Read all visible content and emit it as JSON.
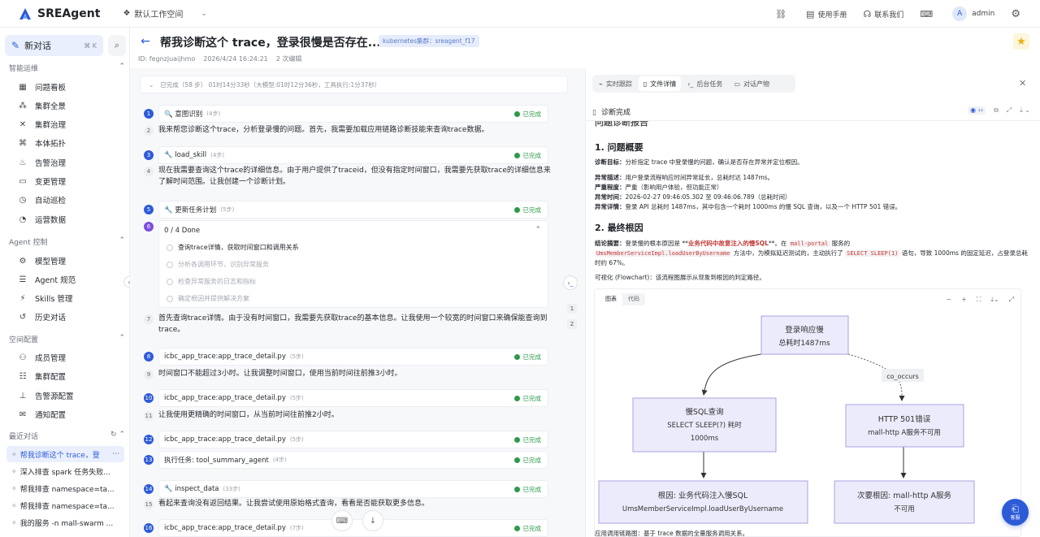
{
  "app": {
    "name": "SREAgent",
    "workspace": "默认工作空间"
  },
  "topbar": {
    "topology": "⛓",
    "manual": "使用手册",
    "contact": "联系我们",
    "lang": "中英",
    "avatar": "A",
    "user": "admin"
  },
  "sidebar": {
    "new_chat": "新对话",
    "shortcut": "⌘ K",
    "sections": [
      {
        "title": "智能运维",
        "items": [
          "问题看板",
          "集群全景",
          "集群治理",
          "本体拓扑",
          "告警治理",
          "变更管理",
          "自动巡检",
          "运营数据"
        ]
      },
      {
        "title": "Agent 控制",
        "items": [
          "模型管理",
          "Agent 规范",
          "Skills 管理",
          "历史对话"
        ]
      },
      {
        "title": "空间配置",
        "items": [
          "成员管理",
          "集群配置",
          "告警源配置",
          "通知配置"
        ]
      }
    ],
    "recent_title": "最近对话",
    "recent": [
      "帮我诊断这个 trace，登",
      "深入排查 spark 任务失败...",
      "帮我排查 namespace=ta...",
      "帮我排查 namespace=ta...",
      "我的服务 -n mall-swarm ..."
    ]
  },
  "header": {
    "title": "帮我诊断这个 trace，登录很慢是否存在...",
    "tag": "kubernetes集群：sreagent_f17",
    "id": "ID: fegnzjuaijhmo",
    "time": "2026/4/24 16:24:21",
    "edits": "2 次编辑"
  },
  "conv": {
    "status": "已完成（58 步） 01时14分33秒（大模型:01时12分36秒，工具执行:1分37秒）",
    "steps": [
      {
        "n": "1",
        "type": "tool",
        "name": "🔍 意图识别",
        "tag": "(4步)"
      },
      {
        "n": "2",
        "type": "msg",
        "text": "我来帮您诊断这个trace，分析登录慢的问题。首先，我需要加载应用链路诊断技能来查询trace数据。"
      },
      {
        "n": "3",
        "type": "tool",
        "name": "🔧 load_skill",
        "tag": "(4步)"
      },
      {
        "n": "4",
        "type": "msg",
        "text": "现在我需要查询这个trace的详细信息。由于用户提供了traceid，但没有指定时间窗口，我需要先获取trace的详细信息来了解时间范围。让我创建一个诊断计划。"
      },
      {
        "n": "5",
        "type": "tool",
        "name": "🔧 更新任务计划",
        "tag": "(5步)"
      },
      {
        "n": "6",
        "type": "plan"
      },
      {
        "n": "7",
        "type": "msg",
        "text": "首先查询trace详情。由于没有时间窗口，我需要先获取trace的基本信息。让我使用一个较宽的时间窗口来确保能查询到trace。"
      },
      {
        "n": "8",
        "type": "tool",
        "name": "icbc_app_trace:app_trace_detail.py",
        "tag": "(5步)"
      },
      {
        "n": "9",
        "type": "msg",
        "text": "时间窗口不能超过3小时。让我调整时间窗口，使用当前时间往前推3小时。"
      },
      {
        "n": "10",
        "type": "tool",
        "name": "icbc_app_trace:app_trace_detail.py",
        "tag": "(5步)"
      },
      {
        "n": "11",
        "type": "msg",
        "text": "让我使用更精确的时间窗口，从当前时间往前推2小时。"
      },
      {
        "n": "12",
        "type": "tool",
        "name": "icbc_app_trace:app_trace_detail.py",
        "tag": "(5步)"
      },
      {
        "n": "13",
        "type": "tool",
        "name": "执行任务: tool_summary_agent",
        "tag": "(4步)"
      },
      {
        "n": "14",
        "type": "tool",
        "name": "🔧 inspect_data",
        "tag": "(33步)"
      },
      {
        "n": "15",
        "type": "msg",
        "text": "看起来查询没有返回结果。让我尝试使用原始格式查询，看看是否能获取更多信息。"
      },
      {
        "n": "16",
        "type": "tool",
        "name": "icbc_app_trace:app_trace_detail.py",
        "tag": "(7步)"
      }
    ],
    "done": "已完成",
    "plan": {
      "header": "0 / 4 Done",
      "todos": [
        "查询trace详情，获取时间窗口和调用关系",
        "分析各调用环节，识别异常服务",
        "检查异常服务的日志和指标",
        "确定根因并提供解决方案"
      ]
    },
    "pages": [
      "1",
      "2"
    ]
  },
  "right": {
    "tabs": [
      "实时跟踪",
      "文件详情",
      "后台任务",
      "对话产物"
    ],
    "doc_name": "诊断完成",
    "cut_heading": "问题诊断报告",
    "h1": "1. 问题概要",
    "goal_label": "诊断目标：",
    "goal": "分析指定 trace 中登录慢的问题，确认是否存在异常并定位根因。",
    "rows": [
      {
        "k": "异常描述：",
        "v": "用户登录流程响应时间异常延长，总耗时达 1487ms。"
      },
      {
        "k": "严重程度：",
        "v": "严重（影响用户体验，但功能正常）"
      },
      {
        "k": "异常时间：",
        "v": "2026-02-27 09:46:05.302 至 09:46:06.789（总耗时间）"
      },
      {
        "k": "异常详情：",
        "v": "登录 API 总耗时 1487ms，其中包含一个耗时 1000ms 的慢 SQL 查询，以及一个 HTTP 501 错误。"
      }
    ],
    "h2": "2. 最终根因",
    "concl_label": "结论摘要：",
    "concl_a": "登录慢的根本原因是 **",
    "concl_red": "业务代码中故意注入的慢SQL",
    "concl_b": "**。在 ",
    "code1": "mall-portal",
    "concl_c": " 服务的",
    "code2": "UmsMemberServiceImpl.loadUserByUsername",
    "concl_d": " 方法中，为模拟延迟测试的，主动执行了 ",
    "code3": "SELECT SLEEP(1)",
    "concl_e": " 语句，导致 1000ms 的固定延迟，占登录总耗时约 67%。",
    "viz": "可视化 (Flowchart)：该流程图展示从现象到根因的判定路径。",
    "diag_tabs": [
      "图表",
      "代码"
    ],
    "nodes": {
      "n1": "登录响应慢",
      "n1b": "总耗时1487ms",
      "n2": "慢SQL查询",
      "n2b": "SELECT SLEEP(?) 耗时",
      "n2c": "1000ms",
      "n3": "HTTP 501错误",
      "n3b": "mall-http A服务不可用",
      "n4": "根因: 业务代码注入慢SQL",
      "n4b": "UmsMemberServiceImpl.loadUserByUsername",
      "n5": "次要根因: mall-http A服务",
      "n5b": "不可用",
      "edge": "co_occurs"
    },
    "tail": "应用调用链路图：基于 trace 数据的全量服务调用关系。"
  },
  "fab": "客服"
}
